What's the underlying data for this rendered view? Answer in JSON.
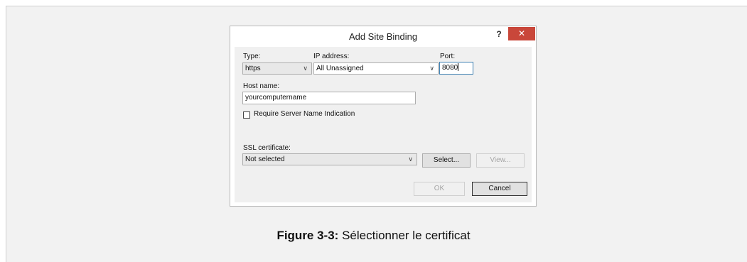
{
  "dialog": {
    "title": "Add Site Binding",
    "help_label": "?",
    "close_label": "✕",
    "type_label": "Type:",
    "type_value": "https",
    "ip_label": "IP address:",
    "ip_value": "All Unassigned",
    "port_label": "Port:",
    "port_value": "8080",
    "host_label": "Host name:",
    "host_value": "yourcomputername",
    "sni_label": "Require Server Name Indication",
    "ssl_label": "SSL certificate:",
    "ssl_value": "Not selected",
    "select_button": "Select...",
    "view_button": "View...",
    "ok_button": "OK",
    "cancel_button": "Cancel"
  },
  "caption": {
    "prefix": "Figure 3-3:",
    "text": " Sélectionner le certificat"
  }
}
